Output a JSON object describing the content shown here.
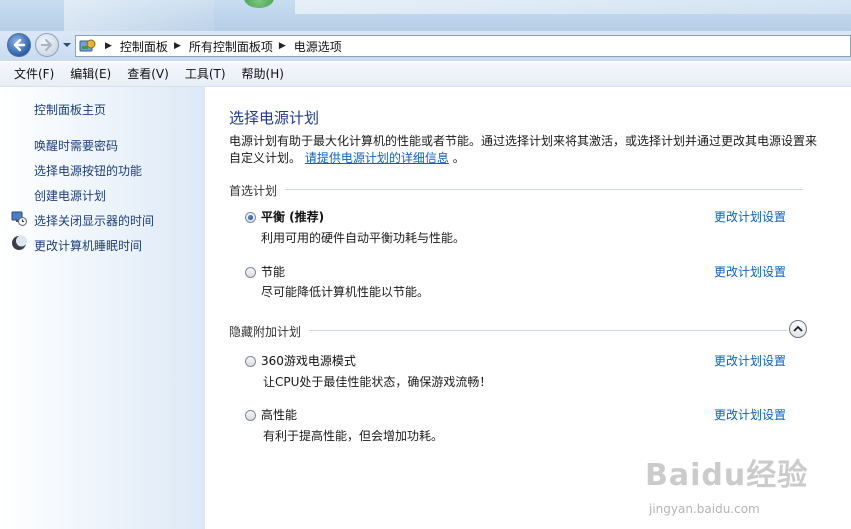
{
  "address_bar": {
    "crumbs": [
      "控制面板",
      "所有控制面板项",
      "电源选项"
    ]
  },
  "menu": [
    "文件(F)",
    "编辑(E)",
    "查看(V)",
    "工具(T)",
    "帮助(H)"
  ],
  "left_pane": {
    "home": "控制面板主页",
    "tasks": [
      "唤醒时需要密码",
      "选择电源按钮的功能",
      "创建电源计划",
      "选择关闭显示器的时间",
      "更改计算机睡眠时间"
    ]
  },
  "main": {
    "title": "选择电源计划",
    "description": "电源计划有助于最大化计算机的性能或者节能。通过选择计划来将其激活，或选择计划并通过更改其电源设置来自定义计划。",
    "description_link": "请提供电源计划的详细信息",
    "description_end": "。",
    "preferred_section": "首选计划",
    "hidden_section": "隐藏附加计划",
    "plans": [
      {
        "name": "平衡 (推荐)",
        "desc": "利用可用的硬件自动平衡功耗与性能。",
        "link": "更改计划设置",
        "selected": true
      },
      {
        "name": "节能",
        "desc": "尽可能降低计算机性能以节能。",
        "link": "更改计划设置",
        "selected": false
      },
      {
        "name": "360游戏电源模式",
        "desc": "让CPU处于最佳性能状态，确保游戏流畅！",
        "link": "更改计划设置",
        "selected": false
      },
      {
        "name": "高性能",
        "desc": "有利于提高性能，但会增加功耗。",
        "link": "更改计划设置",
        "selected": false
      }
    ]
  },
  "watermark": {
    "logo": "Baidu经验",
    "site": "jingyan.baidu.com"
  }
}
